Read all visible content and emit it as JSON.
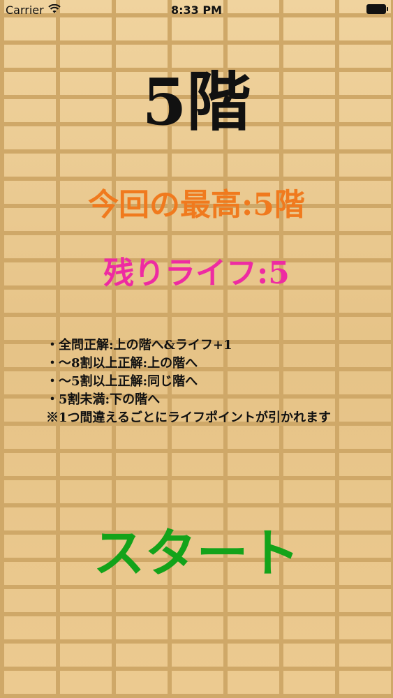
{
  "status_bar": {
    "carrier": "Carrier",
    "time": "8:33 PM",
    "icons": [
      "wifi-icon",
      "battery-icon"
    ]
  },
  "game": {
    "current_floor": "5階",
    "best_record": "今回の最高:5階",
    "remaining_lives": "残りライフ:5"
  },
  "rules": {
    "line1": "・全問正解:上の階へ&ライフ+1",
    "line2": "・〜8割以上正解:上の階へ",
    "line3": "・〜5割以上正解:同じ階へ",
    "line4": "・5割未満:下の階へ",
    "note": "※1つ間違えるごとにライフポイントが引かれます"
  },
  "actions": {
    "start_label": "スタート"
  },
  "colors": {
    "best_record": "#f07a1e",
    "remaining_lives": "#ee2ba2",
    "start": "#13a31a",
    "title": "#111111"
  }
}
